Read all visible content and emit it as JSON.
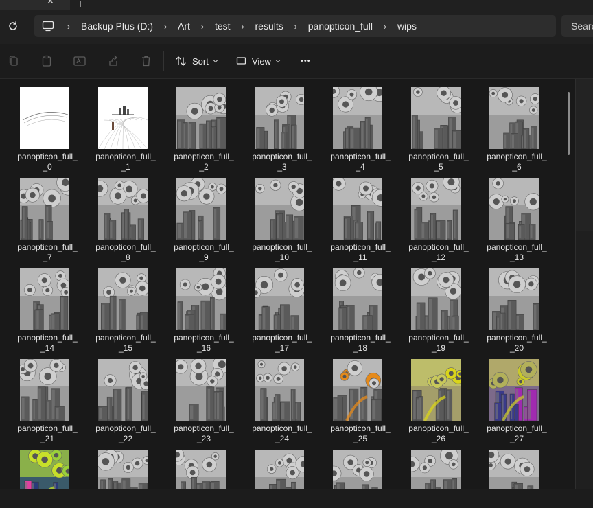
{
  "window": {
    "tab_close_glyph": "✕"
  },
  "address_bar": {
    "root_icon": "computer-icon",
    "crumbs": [
      "Backup Plus (D:)",
      "Art",
      "test",
      "results",
      "panopticon_full",
      "wips"
    ],
    "separator_glyph": "›",
    "search_placeholder": "Search"
  },
  "command_bar": {
    "icons": [
      "copy-icon",
      "paste-icon",
      "rename-icon",
      "share-icon",
      "delete-icon"
    ],
    "sort_label": "Sort",
    "view_label": "View",
    "more_glyph": "•••"
  },
  "files": [
    {
      "line1": "panopticon_full_",
      "line2": "_0",
      "style": "sketch0"
    },
    {
      "line1": "panopticon_full_",
      "line2": "_1",
      "style": "sketch1"
    },
    {
      "line1": "panopticon_full_",
      "line2": "_2",
      "style": "gray"
    },
    {
      "line1": "panopticon_full_",
      "line2": "_3",
      "style": "gray"
    },
    {
      "line1": "panopticon_full_",
      "line2": "_4",
      "style": "gray"
    },
    {
      "line1": "panopticon_full_",
      "line2": "_5",
      "style": "gray"
    },
    {
      "line1": "panopticon_full_",
      "line2": "_6",
      "style": "gray"
    },
    {
      "line1": "panopticon_full_",
      "line2": "_7",
      "style": "gray"
    },
    {
      "line1": "panopticon_full_",
      "line2": "_8",
      "style": "gray"
    },
    {
      "line1": "panopticon_full_",
      "line2": "_9",
      "style": "gray"
    },
    {
      "line1": "panopticon_full_",
      "line2": "_10",
      "style": "gray"
    },
    {
      "line1": "panopticon_full_",
      "line2": "_11",
      "style": "gray"
    },
    {
      "line1": "panopticon_full_",
      "line2": "_12",
      "style": "gray"
    },
    {
      "line1": "panopticon_full_",
      "line2": "_13",
      "style": "gray"
    },
    {
      "line1": "panopticon_full_",
      "line2": "_14",
      "style": "gray"
    },
    {
      "line1": "panopticon_full_",
      "line2": "_15",
      "style": "gray"
    },
    {
      "line1": "panopticon_full_",
      "line2": "_16",
      "style": "gray"
    },
    {
      "line1": "panopticon_full_",
      "line2": "_17",
      "style": "gray"
    },
    {
      "line1": "panopticon_full_",
      "line2": "_18",
      "style": "gray"
    },
    {
      "line1": "panopticon_full_",
      "line2": "_19",
      "style": "gray"
    },
    {
      "line1": "panopticon_full_",
      "line2": "_20",
      "style": "gray"
    },
    {
      "line1": "panopticon_full_",
      "line2": "_21",
      "style": "gray"
    },
    {
      "line1": "panopticon_full_",
      "line2": "_22",
      "style": "gray"
    },
    {
      "line1": "panopticon_full_",
      "line2": "_23",
      "style": "gray"
    },
    {
      "line1": "panopticon_full_",
      "line2": "_24",
      "style": "gray"
    },
    {
      "line1": "panopticon_full_",
      "line2": "_25",
      "style": "orange"
    },
    {
      "line1": "panopticon_full_",
      "line2": "_26",
      "style": "yellow"
    },
    {
      "line1": "panopticon_full_",
      "line2": "_27",
      "style": "psychedelic"
    },
    {
      "line1": "",
      "line2": "",
      "style": "green"
    },
    {
      "line1": "",
      "line2": "",
      "style": "gray"
    },
    {
      "line1": "",
      "line2": "",
      "style": "gray"
    },
    {
      "line1": "",
      "line2": "",
      "style": "gray"
    },
    {
      "line1": "",
      "line2": "",
      "style": "gray"
    },
    {
      "line1": "",
      "line2": "",
      "style": "gray"
    },
    {
      "line1": "",
      "line2": "",
      "style": "gray"
    }
  ],
  "colors": {
    "background": "#191919",
    "toolbar": "#202020",
    "text": "#e6e6e6"
  }
}
